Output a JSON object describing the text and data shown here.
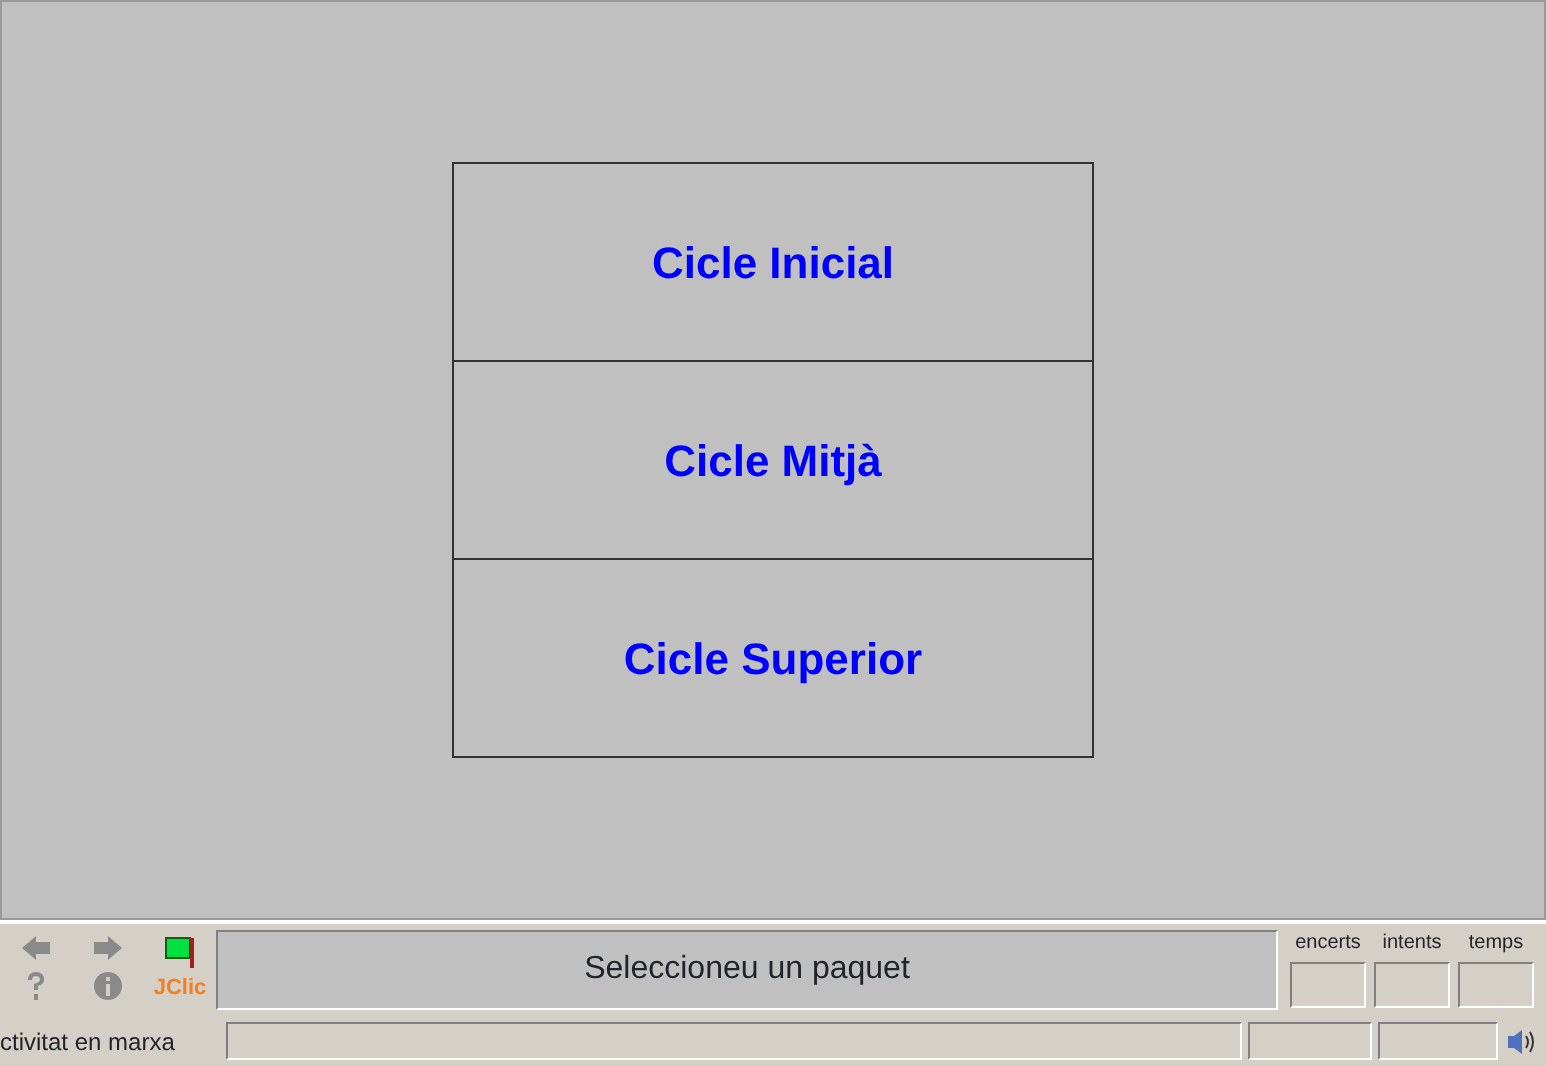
{
  "menu": {
    "items": [
      {
        "label": "Cicle Inicial"
      },
      {
        "label": "Cicle Mitjà"
      },
      {
        "label": "Cicle Superior"
      }
    ]
  },
  "toolbar": {
    "logo": "JClic",
    "message": "Seleccioneu un paquet"
  },
  "counters": [
    {
      "label": "encerts"
    },
    {
      "label": "intents"
    },
    {
      "label": "temps"
    }
  ],
  "status_bar": {
    "text": "ctivitat en marxa"
  }
}
